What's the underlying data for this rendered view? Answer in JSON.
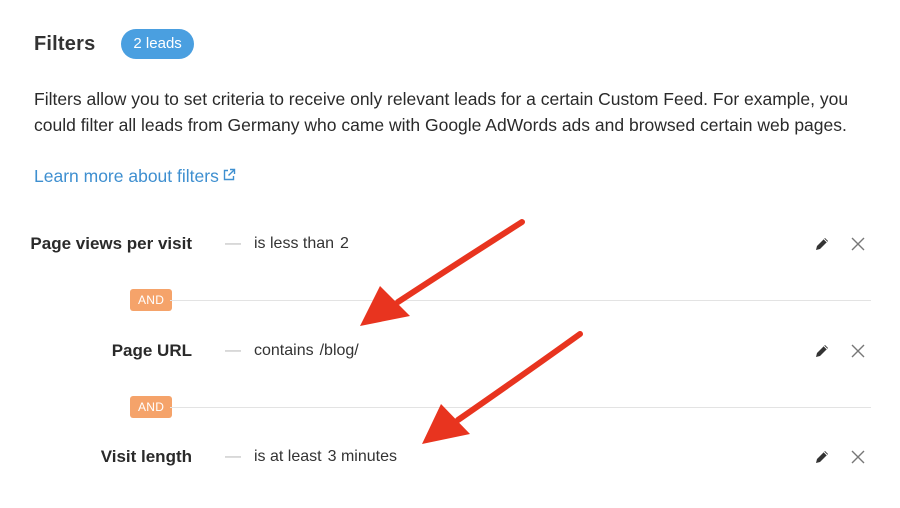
{
  "header": {
    "title": "Filters",
    "leads_badge": "2 leads"
  },
  "description": "Filters allow you to set criteria to receive only relevant leads for a certain Custom Feed. For example, you could filter all leads from Germany who came with Google AdWords ads and browsed certain web pages.",
  "learn_more": {
    "label": "Learn more about filters",
    "icon": "external-link-icon"
  },
  "separator": "—",
  "connector_label": "AND",
  "filters": [
    {
      "name": "Page views per visit",
      "operator": "is less than",
      "value": "2"
    },
    {
      "name": "Page URL",
      "operator": "contains",
      "value": "/blog/"
    },
    {
      "name": "Visit length",
      "operator": "is at least",
      "value": "3 minutes"
    }
  ],
  "row_actions": {
    "edit_icon": "pencil-icon",
    "remove_icon": "close-icon"
  },
  "colors": {
    "badge_blue": "#4a9fe0",
    "link_blue": "#3e8fd0",
    "and_orange": "#f5a36a",
    "annotation_red": "#e8341f"
  }
}
